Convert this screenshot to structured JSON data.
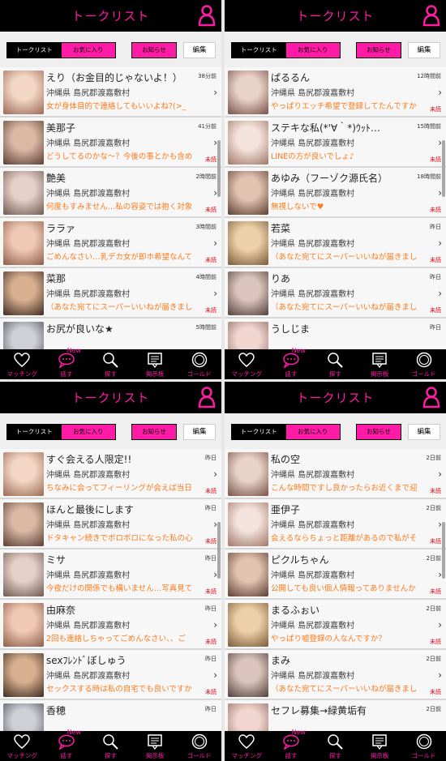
{
  "colors": {
    "accent": "#ff1ba6",
    "message": "#ff7a1a",
    "unread": "#e60012"
  },
  "header": {
    "title": "トークリスト",
    "icon": "person-icon"
  },
  "tabs": {
    "talk_list": "トークリスト",
    "favorites": "お気に入り",
    "notice": "お知らせ",
    "edit": "編集"
  },
  "tabbar": [
    {
      "label": "マッチング",
      "icon": "heart-icon"
    },
    {
      "label": "話す",
      "icon": "speech-bubble-icon",
      "badge": "New"
    },
    {
      "label": "探す",
      "icon": "search-icon"
    },
    {
      "label": "掲示板",
      "icon": "board-icon"
    },
    {
      "label": "ゴールド",
      "icon": "gold-coin-icon"
    }
  ],
  "panels": [
    {
      "rows": [
        {
          "name": "えり（お金目的じゃないよ！）",
          "time": "38分前",
          "location": "沖縄県 島尻郡渡嘉敷村",
          "message": "女が身体目的で連絡してもいいよね?(>_",
          "unread": ""
        },
        {
          "name": "美那子",
          "time": "41分前",
          "location": "沖縄県 島尻郡渡嘉敷村",
          "message": "どうしてるのかな～？今後の事とかも含め",
          "unread": "未読"
        },
        {
          "name": "艶美",
          "time": "2時間前",
          "location": "沖縄県 島尻郡渡嘉敷村",
          "message": "何度もすみません…私の容姿では抱く対象",
          "unread": "未読"
        },
        {
          "name": "ララァ",
          "time": "3時間前",
          "location": "沖縄県 島尻郡渡嘉敷村",
          "message": "ごめんなさい…乳デカ女が即ホ希望なんて",
          "unread": "未読"
        },
        {
          "name": "菜那",
          "time": "4時間前",
          "location": "沖縄県 島尻郡渡嘉敷村",
          "message": "（あなた宛てにスーパーいいねが届きまし",
          "unread": "未読"
        },
        {
          "name": "お尻が良いな★",
          "time": "5時間前",
          "location": "",
          "message": "",
          "unread": ""
        }
      ]
    },
    {
      "rows": [
        {
          "name": "ぱるるん",
          "time": "12時間前",
          "location": "沖縄県 島尻郡渡嘉敷村",
          "message": "やっぱりエッチ希望で登録してたんですか",
          "unread": "未読"
        },
        {
          "name": "ステキな私(*'∀｀*)ｳｯﾄ…",
          "time": "15時間前",
          "location": "沖縄県 島尻郡渡嘉敷村",
          "message": "LINEの方が良いでしょ♪",
          "unread": "未読"
        },
        {
          "name": "あゆみ（フーゾク源氏名）",
          "time": "18時間前",
          "location": "沖縄県 島尻郡渡嘉敷村",
          "message": "無視しないで♥",
          "unread": "未読"
        },
        {
          "name": "若菜",
          "time": "昨日",
          "location": "沖縄県 島尻郡渡嘉敷村",
          "message": "（あなた宛てにスーパーいいねが届きまし",
          "unread": "未読"
        },
        {
          "name": "りあ",
          "time": "昨日",
          "location": "沖縄県 島尻郡渡嘉敷村",
          "message": "（あなた宛てにスーパーいいねが届きまし",
          "unread": "未読"
        },
        {
          "name": "うしじま",
          "time": "昨日",
          "location": "",
          "message": "",
          "unread": ""
        }
      ]
    },
    {
      "rows": [
        {
          "name": "すぐ会える人限定!!",
          "time": "昨日",
          "location": "沖縄県 島尻郡渡嘉敷村",
          "message": "ちなみに会ってフィーリングが会えば当日",
          "unread": "未読"
        },
        {
          "name": "ほんと最後にします",
          "time": "昨日",
          "location": "沖縄県 島尻郡渡嘉敷村",
          "message": "ドタキャン続きでボロボロになった私の心",
          "unread": "未読"
        },
        {
          "name": "ミサ",
          "time": "昨日",
          "location": "沖縄県 島尻郡渡嘉敷村",
          "message": "今夜だけの関係でも構いません…写真見て",
          "unread": "未読"
        },
        {
          "name": "由麻奈",
          "time": "昨日",
          "location": "沖縄県 島尻郡渡嘉敷村",
          "message": "2回も連絡しちゃってごめんなさい、、ご",
          "unread": "未読"
        },
        {
          "name": "sexﾌﾚﾝﾄﾞぼしゅう",
          "time": "昨日",
          "location": "沖縄県 島尻郡渡嘉敷村",
          "message": "セックスする時は私の自宅でも良いですか",
          "unread": "未読"
        },
        {
          "name": "香穂",
          "time": "昨日",
          "location": "",
          "message": "",
          "unread": ""
        }
      ]
    },
    {
      "rows": [
        {
          "name": "私の空",
          "time": "2日前",
          "location": "沖縄県 島尻郡渡嘉敷村",
          "message": "こんな時間ですし良かったらお近くまで迎",
          "unread": "未読"
        },
        {
          "name": "亜伊子",
          "time": "2日前",
          "location": "沖縄県 島尻郡渡嘉敷村",
          "message": "会えるならちょっと距離があるので私がそ",
          "unread": "未読"
        },
        {
          "name": "ピクルちゃん",
          "time": "2日前",
          "location": "沖縄県 島尻郡渡嘉敷村",
          "message": "公開しても良い個人情報ってありませんか",
          "unread": "未読"
        },
        {
          "name": "まるふぉい",
          "time": "2日前",
          "location": "沖縄県 島尻郡渡嘉敷村",
          "message": "やっぱり嘘登録の人なんですか？",
          "unread": "未読"
        },
        {
          "name": "まみ",
          "time": "2日前",
          "location": "沖縄県 島尻郡渡嘉敷村",
          "message": "（あなた宛てにスーパーいいねが届きまし",
          "unread": "未読"
        },
        {
          "name": "セフレ募集→緑黄垢有",
          "time": "2日前",
          "location": "",
          "message": "",
          "unread": ""
        }
      ]
    }
  ]
}
